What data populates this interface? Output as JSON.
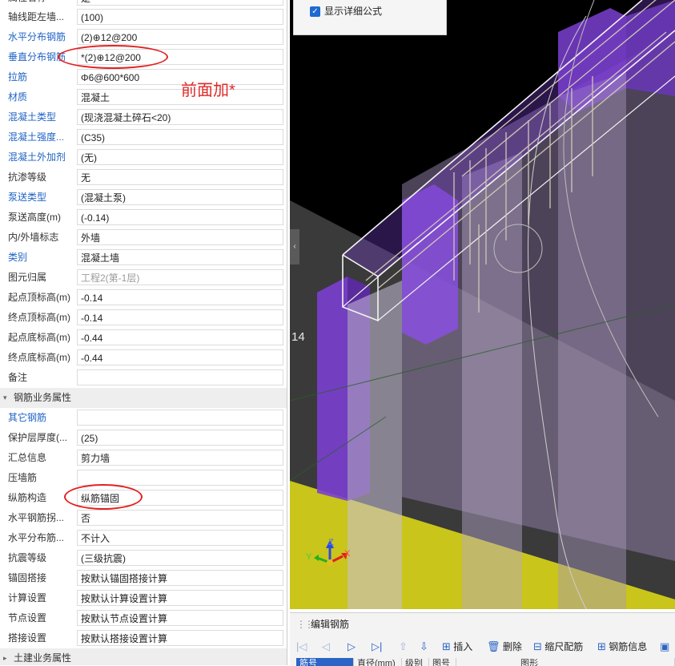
{
  "properties": {
    "top_partial_row": {
      "name": "属性名称",
      "value": "是"
    },
    "rows": [
      {
        "name": "轴线距左墙...",
        "value": "(100)",
        "blue": false
      },
      {
        "name": "水平分布钢筋",
        "value": "(2)⊕12@200",
        "blue": true
      },
      {
        "name": "垂直分布钢筋",
        "value": "*(2)⊕12@200",
        "blue": true
      },
      {
        "name": "拉筋",
        "value": "Φ6@600*600",
        "blue": true
      },
      {
        "name": "材质",
        "value": "混凝土",
        "blue": true
      },
      {
        "name": "混凝土类型",
        "value": "(现浇混凝土碎石<20)",
        "blue": true
      },
      {
        "name": "混凝土强度...",
        "value": "(C35)",
        "blue": true
      },
      {
        "name": "混凝土外加剂",
        "value": "(无)",
        "blue": true
      },
      {
        "name": "抗渗等级",
        "value": "无",
        "blue": false
      },
      {
        "name": "泵送类型",
        "value": "(混凝土泵)",
        "blue": true
      },
      {
        "name": "泵送高度(m)",
        "value": "(-0.14)",
        "blue": false
      },
      {
        "name": "内/外墙标志",
        "value": "外墙",
        "blue": false
      },
      {
        "name": "类别",
        "value": "混凝土墙",
        "blue": true
      },
      {
        "name": "图元归属",
        "value": "工程2(第-1层)",
        "blue": false,
        "grey": true
      },
      {
        "name": "起点顶标高(m)",
        "value": "-0.14",
        "blue": false
      },
      {
        "name": "终点顶标高(m)",
        "value": "-0.14",
        "blue": false
      },
      {
        "name": "起点底标高(m)",
        "value": "-0.44",
        "blue": false
      },
      {
        "name": "终点底标高(m)",
        "value": "-0.44",
        "blue": false
      },
      {
        "name": "备注",
        "value": "",
        "blue": false
      }
    ],
    "group_rebar": {
      "label": "钢筋业务属性"
    },
    "rebar_rows": [
      {
        "name": "其它钢筋",
        "value": "",
        "blue": true
      },
      {
        "name": "保护层厚度(...",
        "value": "(25)",
        "blue": false
      },
      {
        "name": "汇总信息",
        "value": "剪力墙",
        "blue": false
      },
      {
        "name": "压墙筋",
        "value": "",
        "blue": false
      },
      {
        "name": "纵筋构造",
        "value": "纵筋锚固",
        "blue": false
      },
      {
        "name": "水平钢筋拐...",
        "value": "否",
        "blue": false
      },
      {
        "name": "水平分布筋...",
        "value": "不计入",
        "blue": false
      },
      {
        "name": "抗震等级",
        "value": "(三级抗震)",
        "blue": false
      },
      {
        "name": "锚固搭接",
        "value": "按默认锚固搭接计算",
        "blue": false
      },
      {
        "name": "计算设置",
        "value": "按默认计算设置计算",
        "blue": false
      },
      {
        "name": "节点设置",
        "value": "按默认节点设置计算",
        "blue": false
      },
      {
        "name": "搭接设置",
        "value": "按默认搭接设置计算",
        "blue": false
      }
    ],
    "group_civil": {
      "label": "土建业务属性"
    }
  },
  "annotation": {
    "text": "前面加*",
    "color": "#e02a2a"
  },
  "options_panel": {
    "show_formula_label": "显示详细公式",
    "checked": true
  },
  "viewport": {
    "floor_label": "14",
    "axis_x": "X",
    "axis_y": "Y",
    "axis_z": "Z"
  },
  "rebar_editor": {
    "title": "编辑钢筋",
    "toolbar": {
      "insert": "插入",
      "delete": "删除",
      "scale": "缩尺配筋",
      "info": "钢筋信息"
    },
    "columns": [
      "筋号",
      "直径(mm)",
      "级别",
      "图号",
      "图形"
    ]
  },
  "colors": {
    "link_blue": "#1e63c4",
    "annotation_red": "#e32222",
    "wall_purple": "#7b3fd0",
    "floor_yellow": "#d8d41e",
    "accent_blue": "#1d6ad1"
  }
}
